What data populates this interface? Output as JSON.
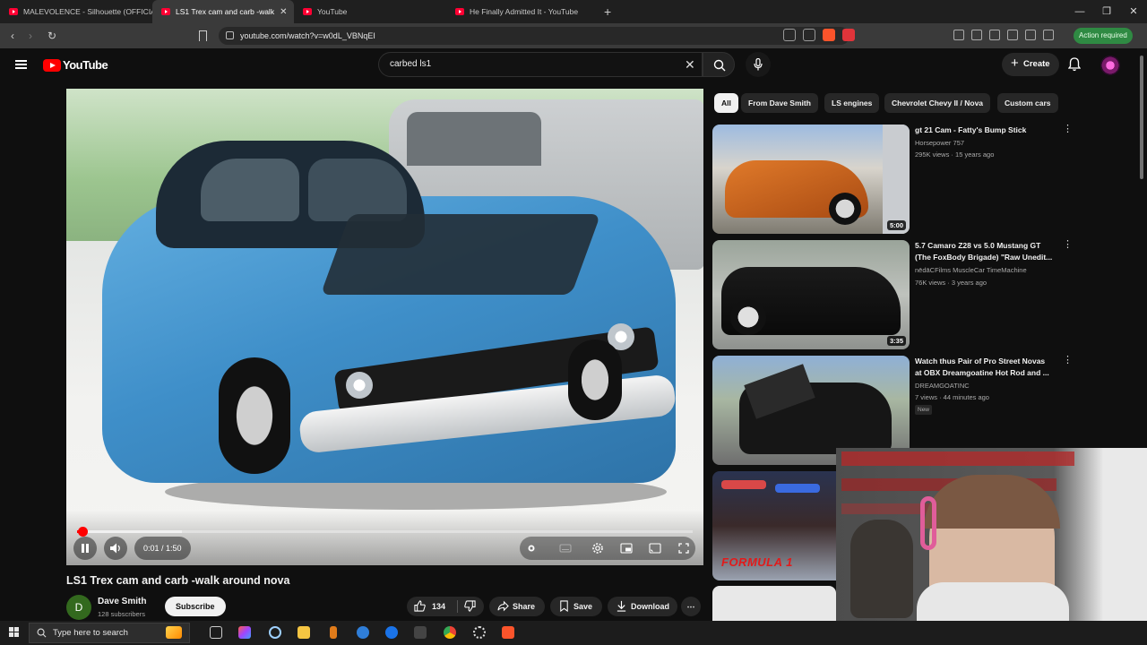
{
  "browser": {
    "tabs": [
      {
        "title": "MALEVOLENCE - Silhouette (OFFICIAL",
        "active": false
      },
      {
        "title": "LS1 Trex cam and carb -walk",
        "active": true
      },
      {
        "title": "YouTube",
        "active": false
      },
      {
        "title": "He Finally Admitted It - YouTube",
        "active": false
      }
    ],
    "url": "youtube.com/watch?v=w0dL_VBNqEI",
    "action_required": "Action required"
  },
  "youtube": {
    "logo_text": "YouTube",
    "search_query": "carbed ls1",
    "create_label": "Create"
  },
  "player": {
    "time": "0:01 / 1:50",
    "progress_fraction": 0.009,
    "buffered_fraction": 0.17
  },
  "video": {
    "title": "LS1 Trex cam and carb -walk around nova",
    "channel": "Dave Smith",
    "channel_initial": "D",
    "subscribers": "128 subscribers",
    "subscribe_label": "Subscribe",
    "likes": "134",
    "share_label": "Share",
    "save_label": "Save",
    "download_label": "Download"
  },
  "chips": [
    "All",
    "From Dave Smith",
    "LS engines",
    "Chevrolet Chevy II / Nova",
    "Custom cars"
  ],
  "recommendations": [
    {
      "title_line1": "gt 21 Cam - Fatty's Bump Stick",
      "title_line2": "",
      "channel": "Horsepower 757",
      "meta": "295K views · 15 years ago",
      "duration": "5:00"
    },
    {
      "title_line1": "5.7 Camaro Z28 vs 5.0 Mustang GT",
      "title_line2": "(The FoxBody Brigade) \"Raw Unedit...",
      "channel": "nēdāCFilms MuscleCar TimeMachine",
      "meta": "76K views · 3 years ago",
      "duration": "3:35"
    },
    {
      "title_line1": "Watch thus Pair of Pro Street Novas",
      "title_line2": "at OBX Dreamgoatine Hot Rod and ...",
      "channel": "DREAMGOATINC",
      "meta": "7 views · 44 minutes ago",
      "duration": "",
      "badge": "New"
    },
    {
      "thumb_text": "FORMULA 1"
    }
  ],
  "taskbar": {
    "search_placeholder": "Type here to search"
  },
  "colors": {
    "yt_red": "#ff0000",
    "background": "#0f0f0f",
    "action_green": "#2f8a43"
  }
}
